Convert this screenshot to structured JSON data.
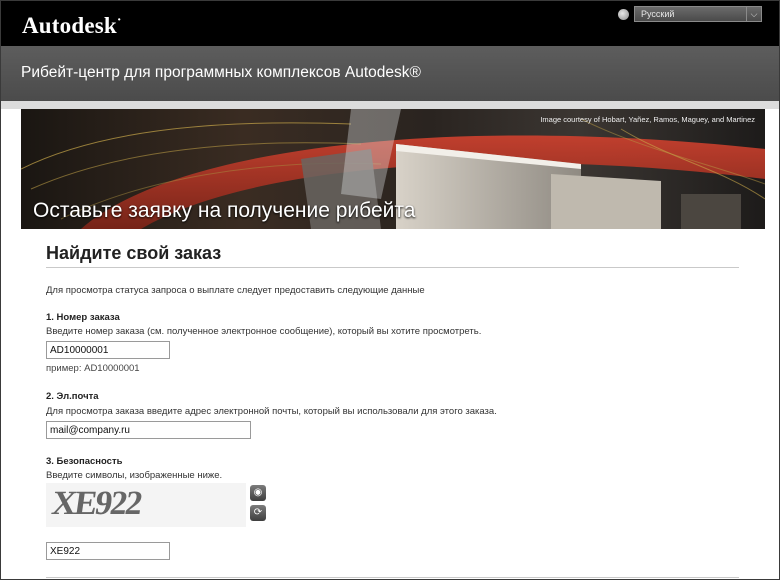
{
  "header": {
    "logo": "Autodesk",
    "logo_mark": "·",
    "language": "Русский",
    "subtitle": "Рибейт-центр для программных комплексов Autodesk®"
  },
  "banner": {
    "credit": "Image courtesy of Hobart, Yañez, Ramos, Maguey, and Martinez",
    "title": "Оставьте заявку на получение рибейта"
  },
  "page": {
    "heading": "Найдите свой заказ",
    "intro": "Для просмотра статуса запроса о выплате следует предоставить следующие данные"
  },
  "order": {
    "title": "1. Номер заказа",
    "description": "Введите номер заказа (см. полученное электронное сообщение), который вы хотите просмотреть.",
    "value": "AD10000001",
    "example": "пример: AD10000001"
  },
  "email": {
    "title": "2. Эл.почта",
    "description": "Для просмотра заказа введите адрес электронной почты, который вы использовали для этого заказа.",
    "value": "mail@company.ru"
  },
  "security": {
    "title": "3. Безопасность",
    "description": "Введите символы, изображенные ниже.",
    "captcha_text": "XE922",
    "value": "XE922"
  },
  "icons": {
    "language": "globe-icon",
    "dropdown": "chevron-down-icon",
    "audio": "audio-captcha-icon",
    "refresh": "refresh-icon"
  }
}
